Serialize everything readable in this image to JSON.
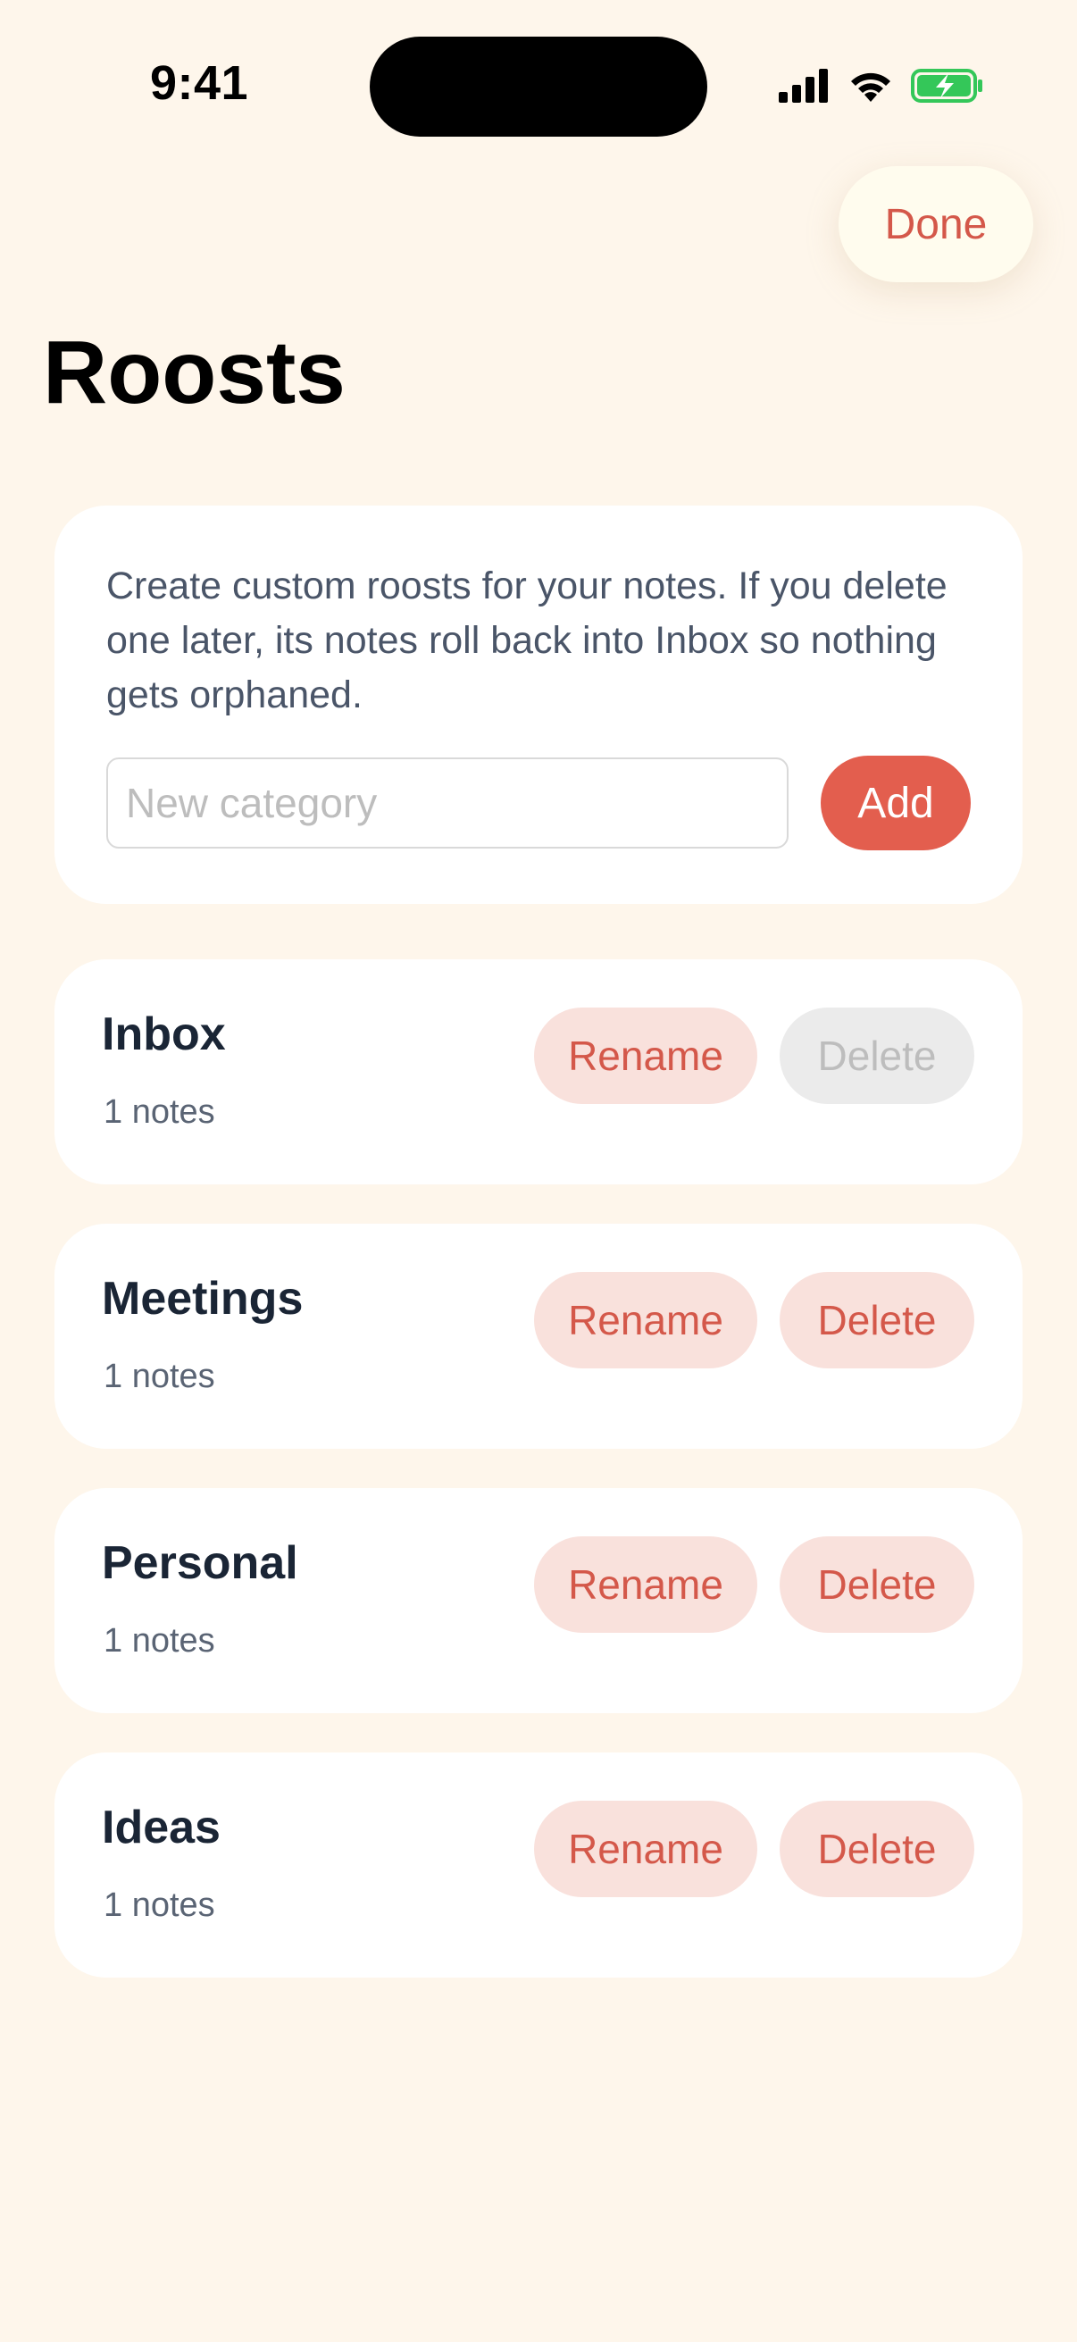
{
  "status_bar": {
    "time": "9:41",
    "icons": [
      "cellular-signal-icon",
      "wifi-icon",
      "battery-charging-icon"
    ]
  },
  "header": {
    "done_label": "Done",
    "title": "Roosts"
  },
  "intro": {
    "text": "Create custom roosts for your notes. If you delete one later, its notes roll back into Inbox so nothing gets orphaned.",
    "input_placeholder": "New category",
    "input_value": "",
    "add_label": "Add"
  },
  "categories": [
    {
      "name": "Inbox",
      "count": "1 notes",
      "rename_label": "Rename",
      "delete_label": "Delete",
      "delete_enabled": false
    },
    {
      "name": "Meetings",
      "count": "1 notes",
      "rename_label": "Rename",
      "delete_label": "Delete",
      "delete_enabled": true
    },
    {
      "name": "Personal",
      "count": "1 notes",
      "rename_label": "Rename",
      "delete_label": "Delete",
      "delete_enabled": true
    },
    {
      "name": "Ideas",
      "count": "1 notes",
      "rename_label": "Rename",
      "delete_label": "Delete",
      "delete_enabled": true
    }
  ],
  "colors": {
    "background": "#FEF6EB",
    "accent": "#E35E4E",
    "accent_text": "#D4584A",
    "pill_bg": "#F9E1DC",
    "disabled_bg": "#EBEBEB",
    "battery_green": "#34C759"
  }
}
